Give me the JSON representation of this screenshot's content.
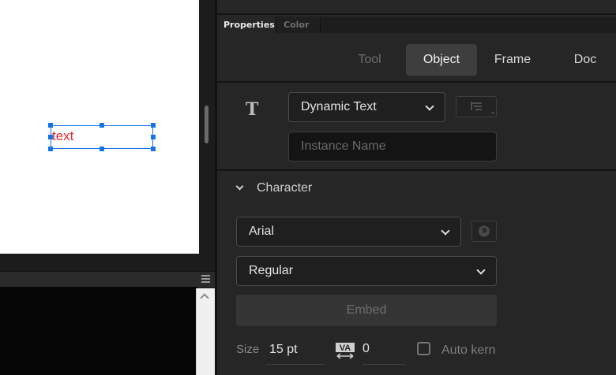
{
  "stage": {
    "text_object": {
      "content": "text",
      "color": "#e3262f"
    },
    "selection_color": "#1473e6"
  },
  "panel": {
    "tabs": [
      {
        "label": "Properties",
        "active": true
      },
      {
        "label": "Color",
        "active": false
      }
    ],
    "modes": [
      {
        "label": "Tool",
        "state": "disabled"
      },
      {
        "label": "Object",
        "state": "active"
      },
      {
        "label": "Frame",
        "state": "normal"
      },
      {
        "label": "Doc",
        "state": "normal"
      }
    ],
    "object": {
      "type_icon": "text-tool-icon",
      "text_type": "Dynamic Text",
      "instance_name_placeholder": "Instance Name"
    },
    "character": {
      "title": "Character",
      "font_family": "Arial",
      "font_style": "Regular",
      "embed_label": "Embed",
      "size_label": "Size",
      "size_value": "15 pt",
      "tracking_icon": "VA",
      "tracking_value": "0",
      "auto_kern_label": "Auto kern",
      "auto_kern_checked": false
    }
  }
}
